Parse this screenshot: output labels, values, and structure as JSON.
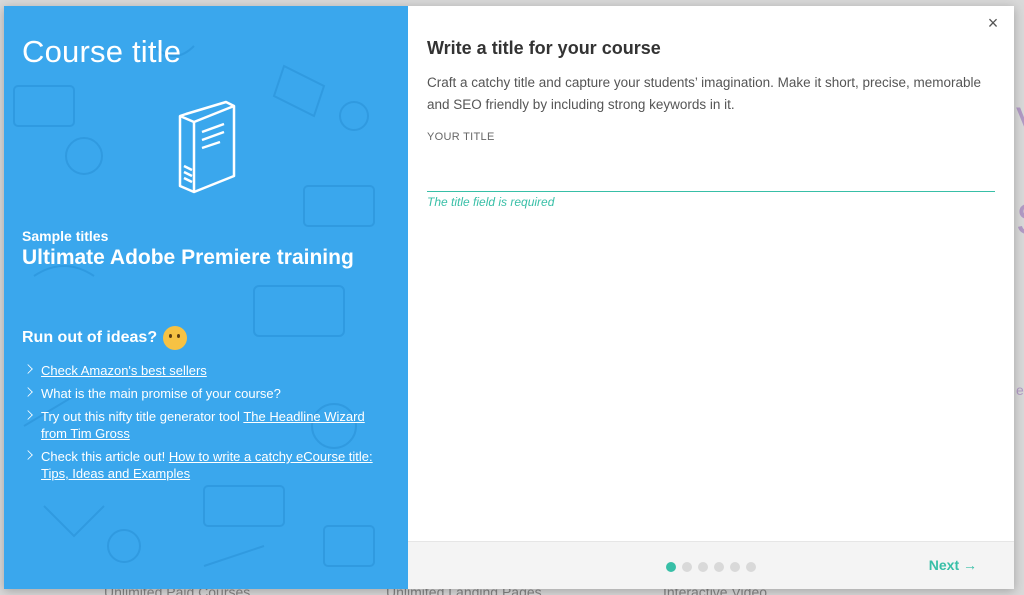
{
  "left": {
    "heading": "Course title",
    "sample_label": "Sample titles",
    "sample_value": "Ultimate Adobe Premiere training",
    "ideas_title": "Run out of ideas?",
    "ideas": [
      {
        "link": "Check Amazon's best sellers",
        "text": ""
      },
      {
        "link": "",
        "text": "What is the main promise of your course?"
      },
      {
        "text": "Try out this nifty title generator tool ",
        "link": "The Headline Wizard from Tim Gross"
      },
      {
        "text": "Check this article out! ",
        "link": "How to write a catchy eCourse title: Tips, Ideas and Examples"
      }
    ]
  },
  "right": {
    "heading": "Write a title for your course",
    "description": "Craft a catchy title and capture your students’ imagination. Make it short, precise, memorable and SEO friendly by including strong keywords in it.",
    "field_label": "YOUR TITLE",
    "title_value": "",
    "error": "The title field is required",
    "close_glyph": "×",
    "next_label": "Next →"
  },
  "footer": {
    "steps": 6,
    "current_step": 1
  },
  "background": {
    "bottom_items": [
      "Unlimited Paid Courses",
      "Unlimited Landing Pages",
      "Interactive Video"
    ]
  },
  "colors": {
    "panel_blue": "#3aa7ed",
    "accent_teal": "#38bfa7"
  }
}
